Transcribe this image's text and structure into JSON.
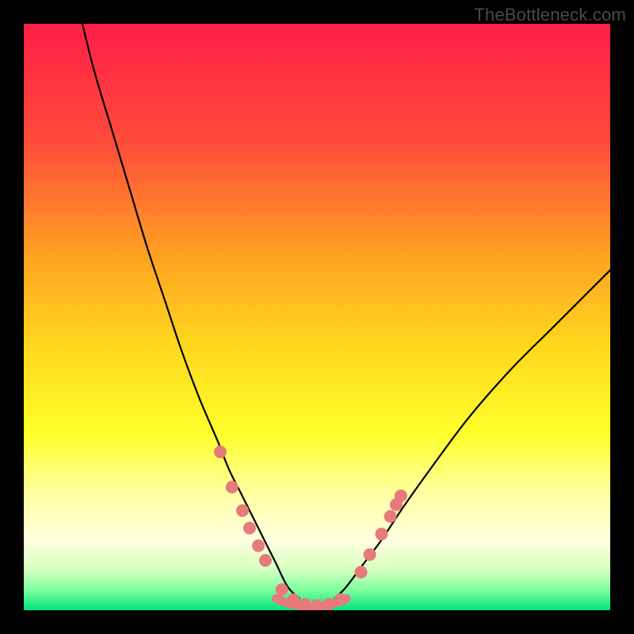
{
  "watermark": "TheBottleneck.com",
  "chart_data": {
    "type": "line",
    "title": "",
    "xlabel": "",
    "ylabel": "",
    "xlim": [
      0,
      100
    ],
    "ylim": [
      0,
      100
    ],
    "grid": false,
    "legend": false,
    "background_gradient": {
      "stops": [
        {
          "offset": 0.0,
          "color": "#ff1f47"
        },
        {
          "offset": 0.2,
          "color": "#ff4b3a"
        },
        {
          "offset": 0.4,
          "color": "#ffa321"
        },
        {
          "offset": 0.55,
          "color": "#ffd81e"
        },
        {
          "offset": 0.7,
          "color": "#ffff2a"
        },
        {
          "offset": 0.8,
          "color": "#ffffa0"
        },
        {
          "offset": 0.88,
          "color": "#ffffe0"
        },
        {
          "offset": 0.93,
          "color": "#d7ffc0"
        },
        {
          "offset": 0.965,
          "color": "#7fff9e"
        },
        {
          "offset": 1.0,
          "color": "#00e47a"
        }
      ]
    },
    "series": [
      {
        "name": "left-curve",
        "color": "#000000",
        "x": [
          10,
          12,
          15,
          18,
          21,
          24,
          27,
          30,
          33,
          35,
          37,
          39,
          41,
          43,
          45,
          47
        ],
        "values": [
          100,
          92,
          82,
          72,
          62,
          53,
          44,
          36,
          29,
          24,
          20,
          16,
          12,
          8,
          4,
          2
        ]
      },
      {
        "name": "right-curve",
        "color": "#000000",
        "x": [
          53,
          55,
          58,
          61,
          65,
          70,
          76,
          83,
          90,
          96,
          100
        ],
        "values": [
          2,
          4,
          8,
          12,
          18,
          25,
          33,
          41,
          48,
          54,
          58
        ]
      },
      {
        "name": "valley-floor",
        "color": "#e77a7a",
        "x": [
          43,
          45,
          47,
          49,
          51,
          53,
          55
        ],
        "values": [
          2,
          1.2,
          0.8,
          0.7,
          0.8,
          1.2,
          2
        ]
      }
    ],
    "markers": {
      "name": "data-points",
      "color": "#e77a7a",
      "radius": 8,
      "points": [
        {
          "x": 33.5,
          "y": 27
        },
        {
          "x": 35.5,
          "y": 21
        },
        {
          "x": 37.3,
          "y": 17
        },
        {
          "x": 38.5,
          "y": 14
        },
        {
          "x": 40.0,
          "y": 11
        },
        {
          "x": 41.2,
          "y": 8.5
        },
        {
          "x": 44.0,
          "y": 3.5
        },
        {
          "x": 46.0,
          "y": 1.8
        },
        {
          "x": 48.0,
          "y": 1.0
        },
        {
          "x": 50.0,
          "y": 0.8
        },
        {
          "x": 52.0,
          "y": 1.0
        },
        {
          "x": 54.0,
          "y": 1.8
        },
        {
          "x": 57.5,
          "y": 6.5
        },
        {
          "x": 59.0,
          "y": 9.5
        },
        {
          "x": 61.0,
          "y": 13
        },
        {
          "x": 62.5,
          "y": 16
        },
        {
          "x": 63.5,
          "y": 18
        },
        {
          "x": 64.3,
          "y": 19.5
        }
      ]
    }
  }
}
